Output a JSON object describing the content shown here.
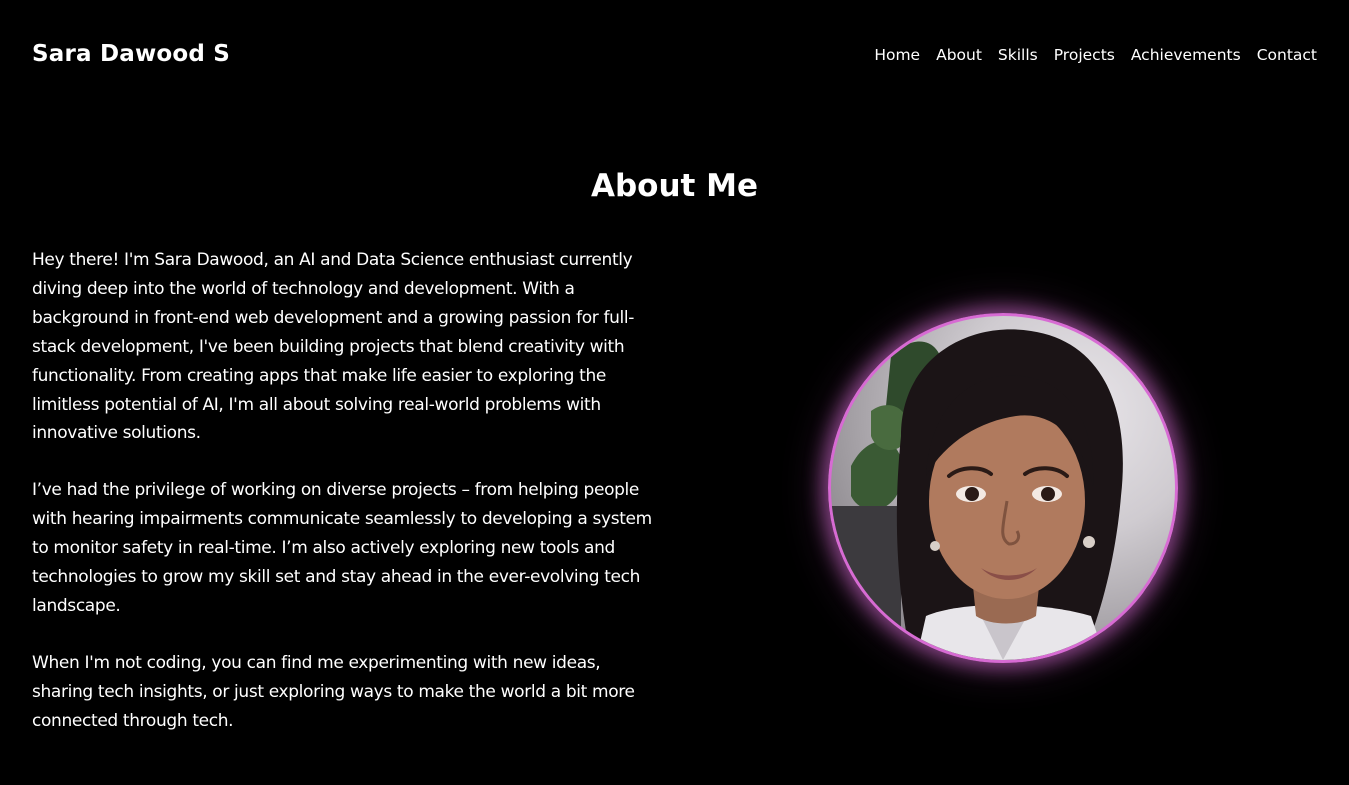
{
  "header": {
    "brand": "Sara Dawood S",
    "nav": [
      {
        "label": "Home"
      },
      {
        "label": "About"
      },
      {
        "label": "Skills"
      },
      {
        "label": "Projects"
      },
      {
        "label": "Achievements"
      },
      {
        "label": "Contact"
      }
    ]
  },
  "about": {
    "title": "About Me",
    "paragraphs": [
      "Hey there! I'm Sara Dawood, an AI and Data Science enthusiast currently diving deep into the world of technology and development. With a background in front-end web development and a growing passion for full-stack development, I've been building projects that blend creativity with functionality. From creating apps that make life easier to exploring the limitless potential of AI, I'm all about solving real-world problems with innovative solutions.",
      "I’ve had the privilege of working on diverse projects – from helping people with hearing impairments communicate seamlessly to developing a system to monitor safety in real-time. I’m also actively exploring new tools and technologies to grow my skill set and stay ahead in the ever-evolving tech landscape.",
      "When I'm not coding, you can find me experimenting with new ideas, sharing tech insights, or just exploring ways to make the world a bit more connected through tech."
    ],
    "photo": {
      "glow_color": "#d76bd3"
    }
  },
  "colors": {
    "background": "#000000",
    "text": "#ffffff",
    "accent": "#d76bd3"
  }
}
